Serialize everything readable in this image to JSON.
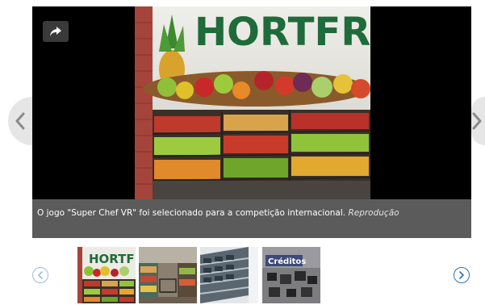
{
  "gallery": {
    "caption_text": "O jogo \"Super Chef VR\" foi selecionado para a competição internacional.",
    "caption_credit": "Reprodução",
    "photo_sign": "HORTFR",
    "thumbnails": [
      {
        "label": "HORTFI"
      },
      {
        "label": ""
      },
      {
        "label": ""
      },
      {
        "label": "Créditos"
      }
    ]
  },
  "icons": {
    "share": "share-arrow-icon",
    "prev_main": "chevron-left-icon",
    "next_main": "chevron-right-icon",
    "prev_thumbs": "chevron-left-circle-icon",
    "next_thumbs": "chevron-right-circle-icon"
  },
  "colors": {
    "frame": "#000000",
    "caption_bg": "#5b5b5b",
    "thumb_nav_active": "#2f72b0",
    "thumb_nav_disabled": "#9cbedb"
  }
}
